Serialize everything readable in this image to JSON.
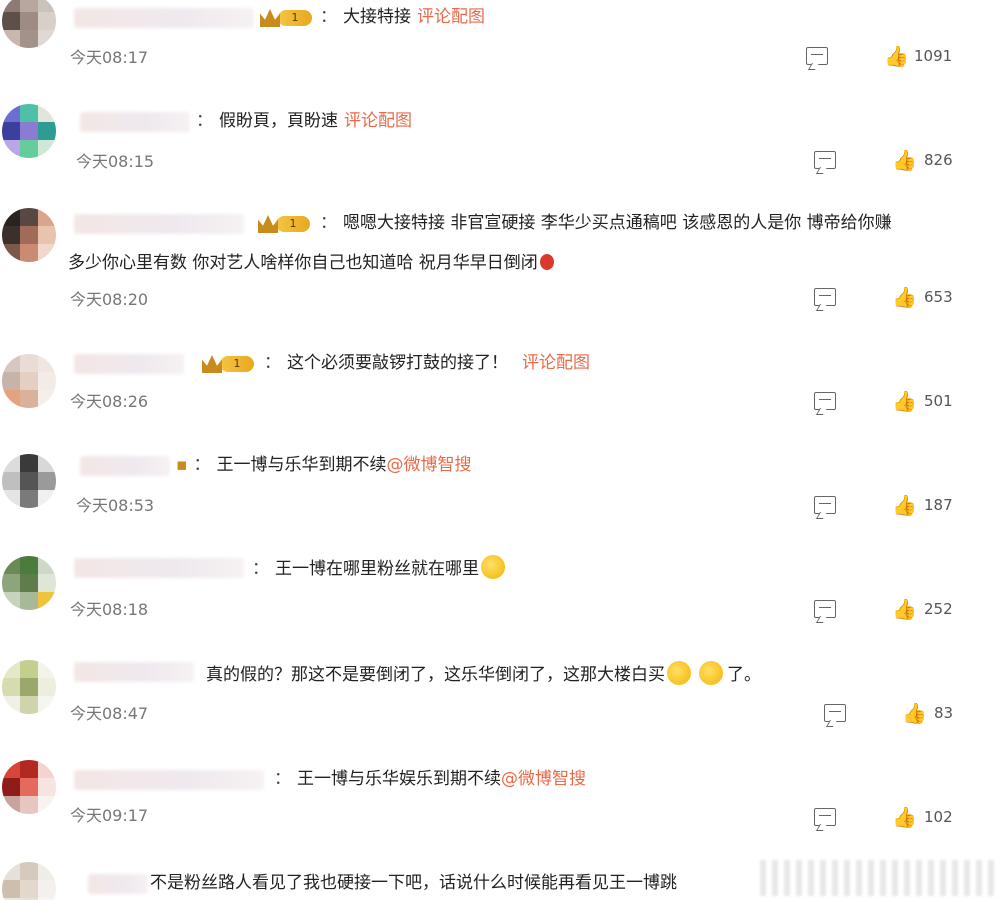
{
  "comments": [
    {
      "text": "大接特接",
      "tag": "评论配图",
      "time": "今天08:17",
      "likes": "1091"
    },
    {
      "text": "假盼頁，頁盼速",
      "tag": "评论配图",
      "time": "今天08:15",
      "likes": "826"
    },
    {
      "text": "嗯嗯大接特接 非官宣硬接 李华少买点通稿吧 该感恩的人是你 博帝给你赚",
      "text2": "多少你心里有数 你对艺人啥样你自己也知道哈 祝月华早日倒闭",
      "time": "今天08:20",
      "likes": "653"
    },
    {
      "text": "这个必须要敲锣打鼓的接了！",
      "tag": "评论配图",
      "time": "今天08:26",
      "likes": "501"
    },
    {
      "text": "王一博与乐华到期不续",
      "tag": "@微博智搜",
      "time": "今天08:53",
      "likes": "187"
    },
    {
      "text": "王一博在哪里粉丝就在哪里",
      "time": "今天08:18",
      "likes": "252"
    },
    {
      "text": "真的假的？那这不是要倒闭了，这乐华倒闭了，这那大楼白买",
      "text_end": "了。",
      "time": "今天08:47",
      "likes": "83"
    },
    {
      "text": "王一博与乐华娱乐到期不续",
      "tag": "@微博智搜",
      "time": "今天09:17",
      "likes": "102"
    },
    {
      "text": "不是粉丝路人看见了我也硬接一下吧，话说什么时候能再看见王一博跳"
    }
  ],
  "colors": {
    "tag": "#e86a4a",
    "badge": "#e8a91d",
    "text": "#222222",
    "meta": "#777777"
  },
  "icons": {
    "reply": "comment-icon",
    "like": "thumbs-up-icon",
    "badge": "crown-badge-icon"
  }
}
